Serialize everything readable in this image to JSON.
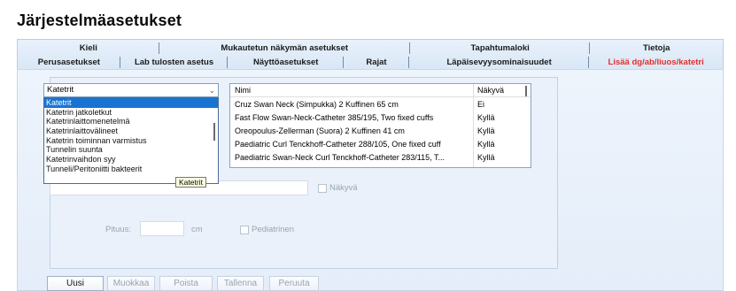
{
  "window": {
    "title": "Järjestelmäasetukset"
  },
  "tabs": {
    "row1": [
      {
        "label": "Kieli"
      },
      {
        "label": "Mukautetun näkymän asetukset"
      },
      {
        "label": "Tapahtumaloki"
      },
      {
        "label": "Tietoja"
      }
    ],
    "row2": [
      {
        "label": "Perusasetukset"
      },
      {
        "label": "Lab tulosten asetus"
      },
      {
        "label": "Näyttöasetukset"
      },
      {
        "label": "Rajat"
      },
      {
        "label": "Läpäisevyysominaisuudet"
      },
      {
        "label": "Lisää dg/ab/liuos/katetri",
        "active": true
      }
    ]
  },
  "category_select": {
    "selected": "Katetrit",
    "options": [
      "Katetrit",
      "Katetrin jatkoletkut",
      "Katetrinlaittomenetelmä",
      "Katetrinlaittovälineet",
      "Katetrin toiminnan varmistus",
      "Tunnelin suunta",
      "Katetrinvaihdon syy",
      "Tunneli/Peritoniitti bakteerit"
    ],
    "tooltip": "Katetrit"
  },
  "table": {
    "headers": {
      "name": "Nimi",
      "visible": "Näkyvä"
    },
    "rows": [
      {
        "name": "Cruz Swan Neck (Simpukka) 2 Kuffinen 65 cm",
        "visible": "Ei"
      },
      {
        "name": "Fast Flow Swan-Neck-Catheter 385/195, Two fixed cuffs",
        "visible": "Kyllä"
      },
      {
        "name": "Oreopoulus-Zellerman (Suora) 2 Kuffinen 41 cm",
        "visible": "Kyllä"
      },
      {
        "name": "Paediatric Curl Tenckhoff-Catheter 288/105, One fixed cuff",
        "visible": "Kyllä"
      },
      {
        "name": "Paediatric Swan-Neck Curl Tenckhoff-Catheter 283/115, T...",
        "visible": "Kyllä"
      }
    ]
  },
  "form": {
    "name_value": "",
    "visible_label": "Näkyvä",
    "length_label": "Pituus:",
    "length_value": "",
    "length_unit": "cm",
    "pediatric_label": "Pediatrinen"
  },
  "buttons": {
    "new": "Uusi",
    "edit": "Muokkaa",
    "delete": "Poista",
    "save": "Tallenna",
    "cancel": "Peruuta"
  },
  "colors": {
    "active_tab": "#e0312c",
    "selection": "#1874d2",
    "panel_bg": "#e4edf9"
  }
}
